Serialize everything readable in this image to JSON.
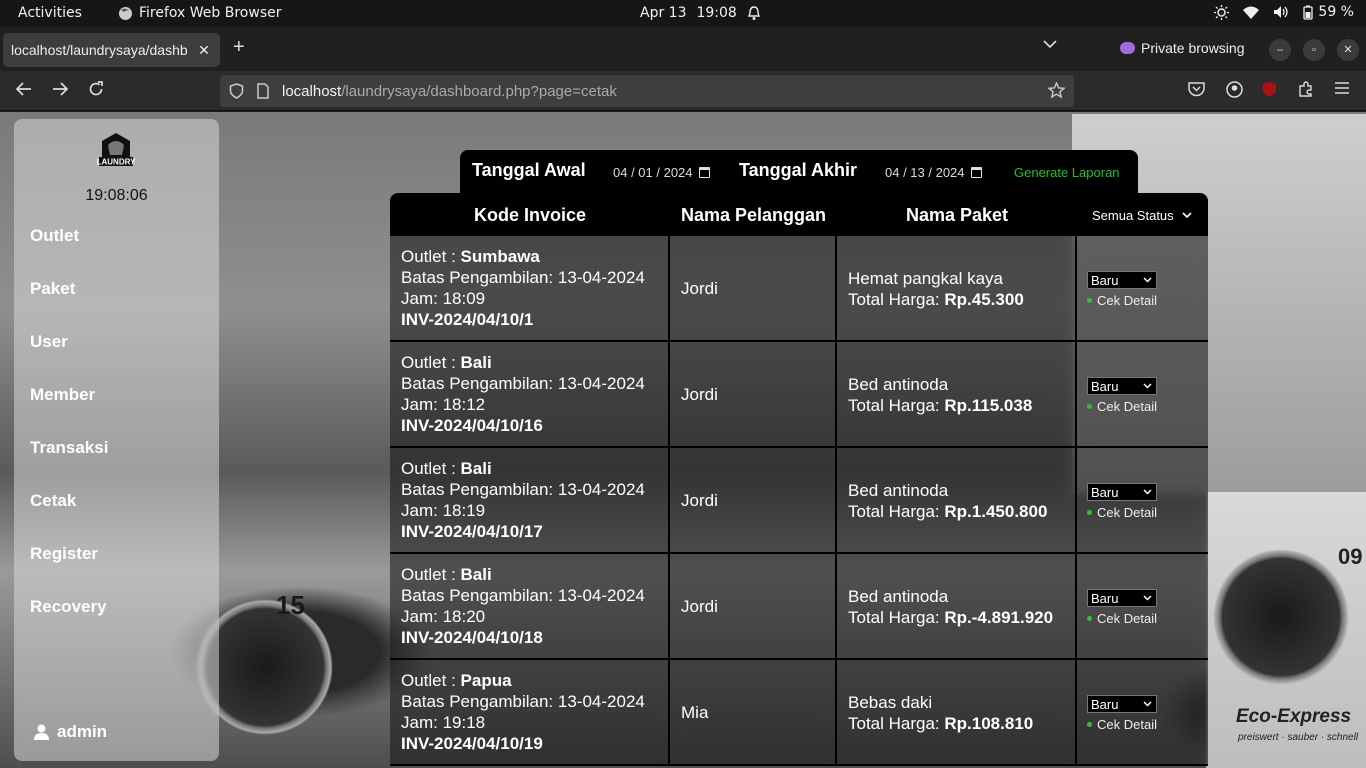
{
  "system": {
    "activities": "Activities",
    "app_name": "Firefox Web Browser",
    "date": "Apr 13",
    "time": "19:08",
    "battery": "59 %"
  },
  "browser": {
    "tab_title": "localhost/laundrysaya/dashb",
    "private_label": "Private browsing",
    "url_host": "localhost",
    "url_path": "/laundrysaya/dashboard.php?page=cetak"
  },
  "sidebar": {
    "logo_text": "LAUNDRY",
    "clock": "19:08:06",
    "menu": [
      {
        "label": "Outlet"
      },
      {
        "label": "Paket"
      },
      {
        "label": "User"
      },
      {
        "label": "Member"
      },
      {
        "label": "Transaksi"
      },
      {
        "label": "Cetak"
      },
      {
        "label": "Register"
      },
      {
        "label": "Recovery"
      }
    ],
    "username": "admin"
  },
  "report": {
    "start_label": "Tanggal Awal",
    "start_date": "04 / 01 / 2024",
    "end_label": "Tanggal Akhir",
    "end_date": "04 / 13 / 2024",
    "generate_label": "Generate Laporan"
  },
  "table": {
    "headers": {
      "invoice": "Kode Invoice",
      "customer": "Nama Pelanggan",
      "package": "Nama Paket",
      "status_filter": "Semua Status"
    },
    "outlet_prefix": "Outlet : ",
    "pickup_prefix": "Batas Pengambilan: ",
    "time_prefix": "Jam: ",
    "total_prefix": "Total Harga: ",
    "detail_label": "Cek Detail",
    "rows": [
      {
        "outlet": "Sumbawa",
        "pickup": "13-04-2024",
        "time": "18:09",
        "invoice": "INV-2024/04/10/1",
        "customer": "Jordi",
        "package": "Hemat pangkal kaya",
        "total": "Rp.45.300",
        "status": "Baru"
      },
      {
        "outlet": "Bali",
        "pickup": "13-04-2024",
        "time": "18:12",
        "invoice": "INV-2024/04/10/16",
        "customer": "Jordi",
        "package": "Bed antinoda",
        "total": "Rp.115.038",
        "status": "Baru"
      },
      {
        "outlet": "Bali",
        "pickup": "13-04-2024",
        "time": "18:19",
        "invoice": "INV-2024/04/10/17",
        "customer": "Jordi",
        "package": "Bed antinoda",
        "total": "Rp.1.450.800",
        "status": "Baru"
      },
      {
        "outlet": "Bali",
        "pickup": "13-04-2024",
        "time": "18:20",
        "invoice": "INV-2024/04/10/18",
        "customer": "Jordi",
        "package": "Bed antinoda",
        "total": "Rp.-4.891.920",
        "status": "Baru"
      },
      {
        "outlet": "Papua",
        "pickup": "13-04-2024",
        "time": "19:18",
        "invoice": "INV-2024/04/10/19",
        "customer": "Mia",
        "package": "Bebas daki",
        "total": "Rp.108.810",
        "status": "Baru"
      }
    ]
  },
  "background": {
    "brand": "Eco-Express",
    "brand_sub": "preiswert · sauber · schnell",
    "machine_number_left": "15",
    "machine_number_right": "09"
  }
}
